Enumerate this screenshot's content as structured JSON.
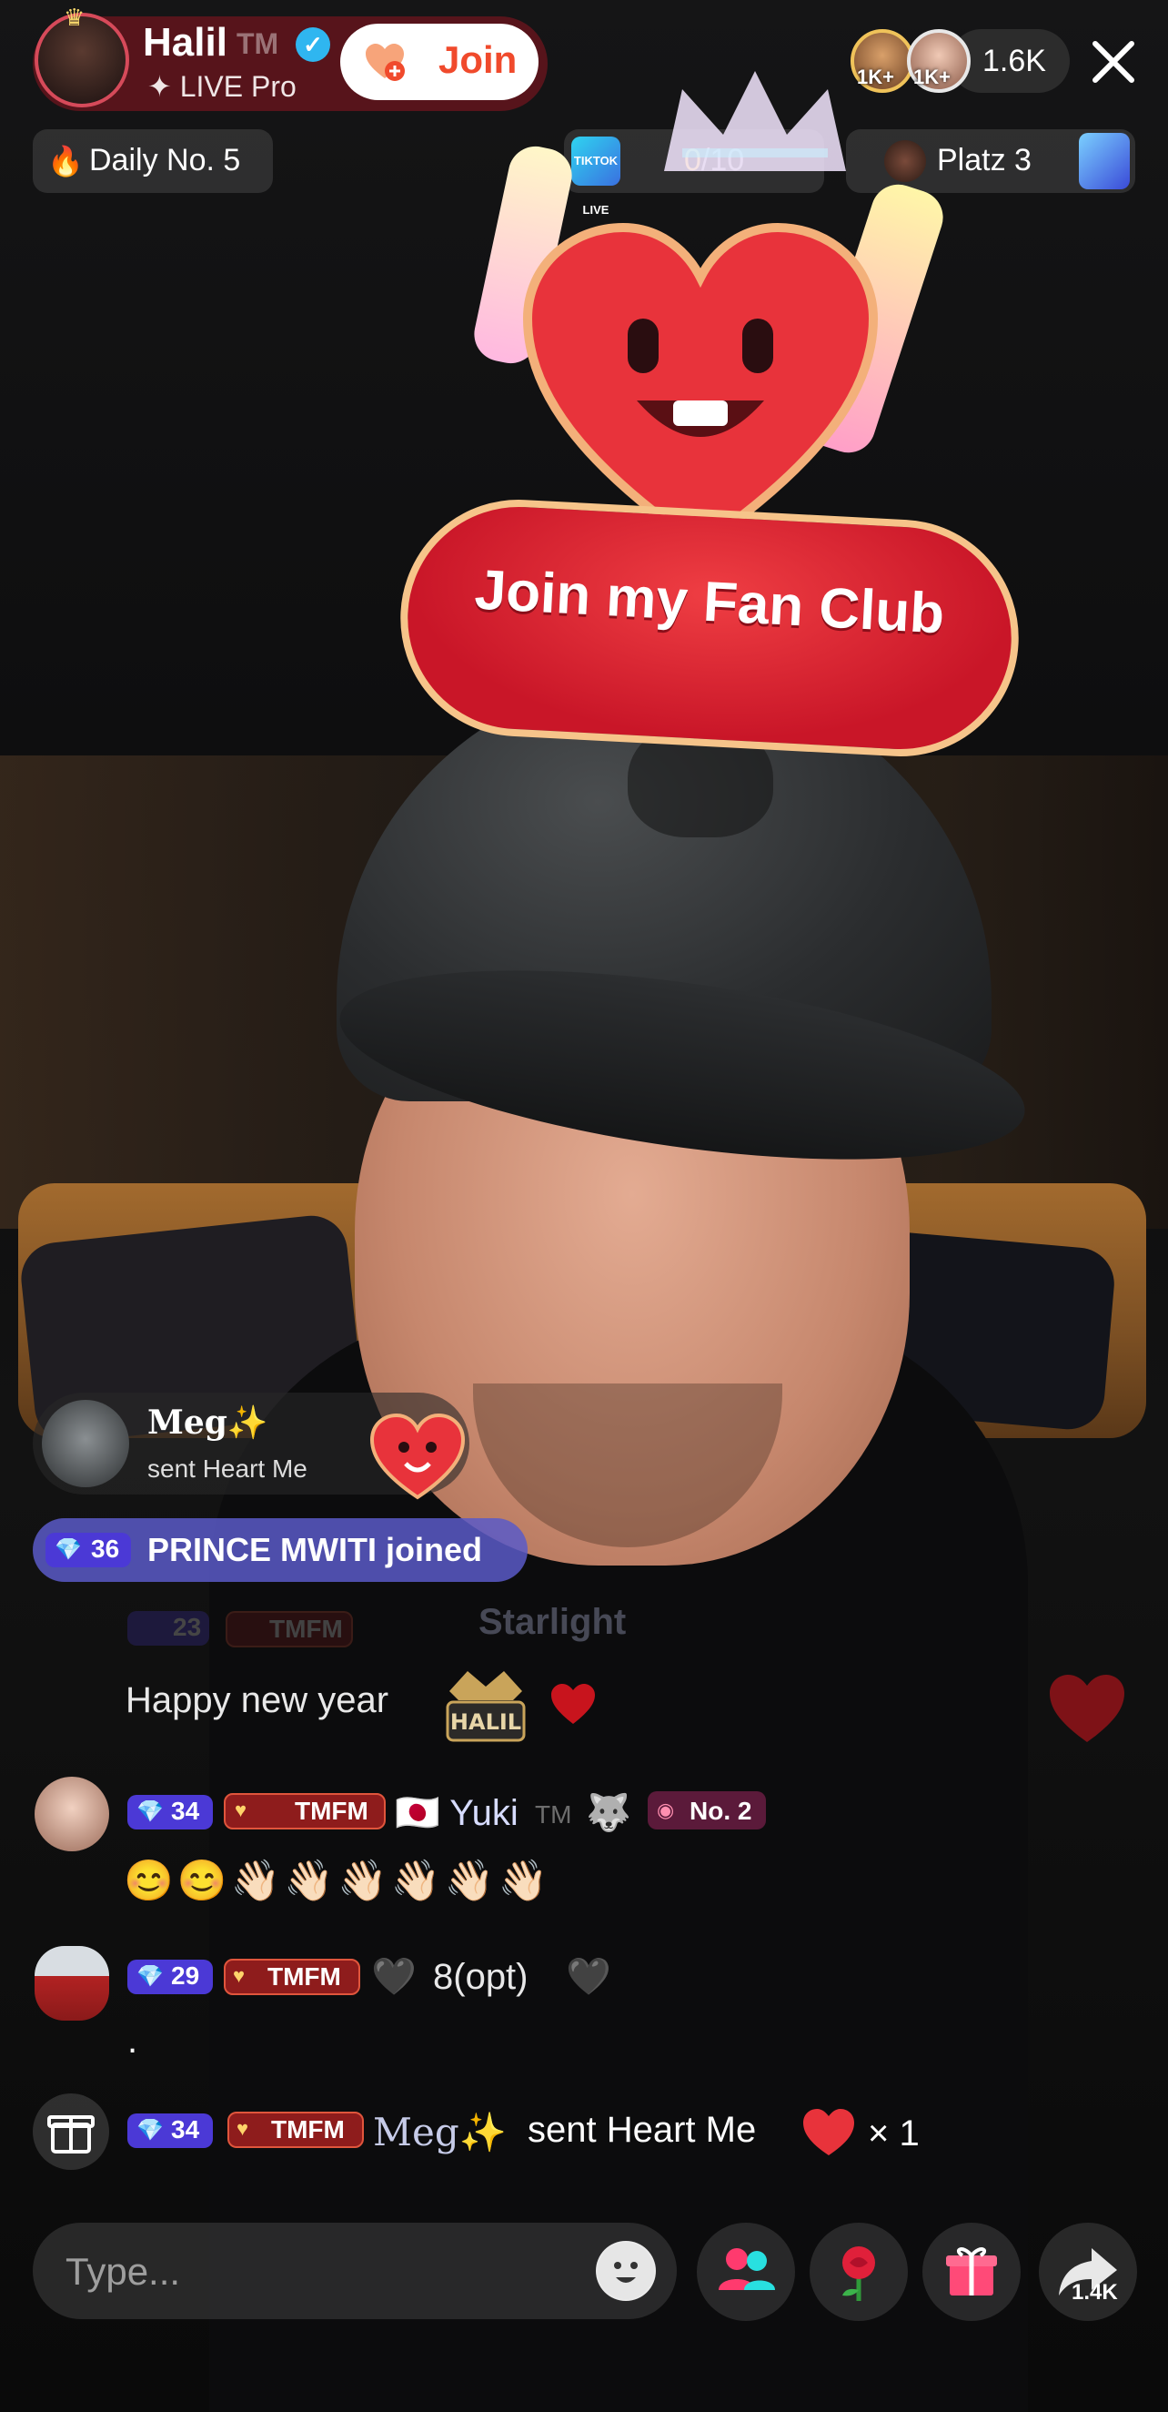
{
  "host": {
    "name": "Halil",
    "tm": "TM",
    "subtitle": "LIVE Pro",
    "join_label": "Join"
  },
  "viewers": {
    "badge_a": "1K+",
    "badge_b": "1K+",
    "count": "1.6K"
  },
  "daily": {
    "text": "Daily No. 5"
  },
  "goal": {
    "done": "0",
    "total": "/10",
    "icon_text": "TIKTOK LIVE"
  },
  "rank": {
    "text": "Platz 3"
  },
  "fanclub": {
    "label": "Join my Fan Club"
  },
  "gift_notification": {
    "name": "Meg✨",
    "subtitle": "sent Heart Me"
  },
  "joined": {
    "level": "36",
    "text": "PRINCE MWITI joined"
  },
  "faded_message": {
    "level": "23",
    "badge": "TMFM",
    "name": "Starlight"
  },
  "chat": [
    {
      "text": "Happy new year"
    },
    {
      "level": "34",
      "badge": "TMFM",
      "name": "Yuki",
      "tm": "TM",
      "rank": "No. 2",
      "message": "😊😊👋🏻👋🏻👋🏻👋🏻👋🏻👋🏻"
    },
    {
      "level": "29",
      "badge": "TMFM",
      "text": "8(opt)",
      "message": "."
    }
  ],
  "gift_line": {
    "level": "34",
    "badge": "TMFM",
    "name": "Meg✨",
    "text": "sent Heart Me",
    "count": "× 1"
  },
  "input": {
    "placeholder": "Type..."
  },
  "share": {
    "count": "1.4K"
  },
  "colors": {
    "accent_red": "#f04a2c",
    "level_purple": "#4b39d6",
    "tmfm_red": "#8e1c1c",
    "verified_blue": "#2fb6f0"
  }
}
